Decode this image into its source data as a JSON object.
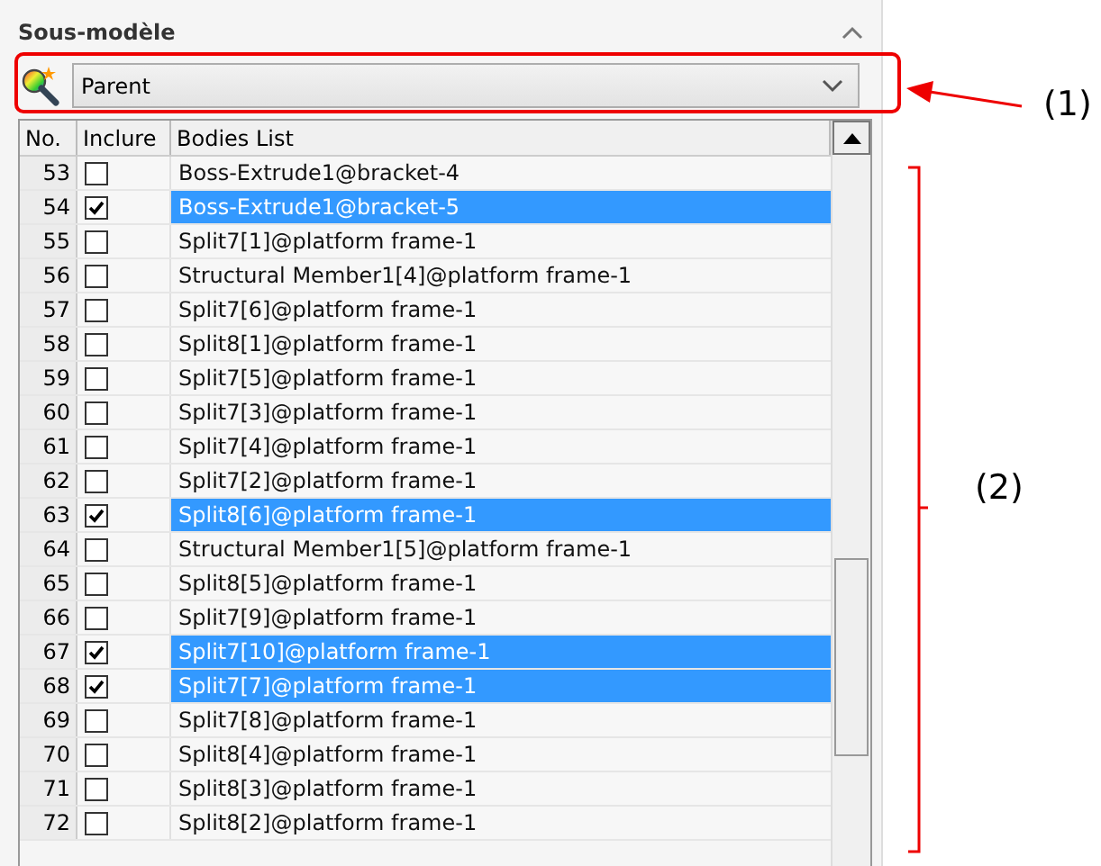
{
  "panel": {
    "title": "Sous-modèle",
    "collapsed": false
  },
  "dropdown": {
    "value": "Parent"
  },
  "table": {
    "columns": [
      "No.",
      "Inclure",
      "Bodies List"
    ],
    "rows": [
      {
        "no": "53",
        "checked": false,
        "selected": false,
        "name": "Boss-Extrude1@bracket-4"
      },
      {
        "no": "54",
        "checked": true,
        "selected": true,
        "name": "Boss-Extrude1@bracket-5"
      },
      {
        "no": "55",
        "checked": false,
        "selected": false,
        "name": "Split7[1]@platform frame-1"
      },
      {
        "no": "56",
        "checked": false,
        "selected": false,
        "name": "Structural Member1[4]@platform frame-1"
      },
      {
        "no": "57",
        "checked": false,
        "selected": false,
        "name": "Split7[6]@platform frame-1"
      },
      {
        "no": "58",
        "checked": false,
        "selected": false,
        "name": "Split8[1]@platform frame-1"
      },
      {
        "no": "59",
        "checked": false,
        "selected": false,
        "name": "Split7[5]@platform frame-1"
      },
      {
        "no": "60",
        "checked": false,
        "selected": false,
        "name": "Split7[3]@platform frame-1"
      },
      {
        "no": "61",
        "checked": false,
        "selected": false,
        "name": "Split7[4]@platform frame-1"
      },
      {
        "no": "62",
        "checked": false,
        "selected": false,
        "name": "Split7[2]@platform frame-1"
      },
      {
        "no": "63",
        "checked": true,
        "selected": true,
        "name": "Split8[6]@platform frame-1"
      },
      {
        "no": "64",
        "checked": false,
        "selected": false,
        "name": "Structural Member1[5]@platform frame-1"
      },
      {
        "no": "65",
        "checked": false,
        "selected": false,
        "name": "Split8[5]@platform frame-1"
      },
      {
        "no": "66",
        "checked": false,
        "selected": false,
        "name": "Split7[9]@platform frame-1"
      },
      {
        "no": "67",
        "checked": true,
        "selected": true,
        "name": "Split7[10]@platform frame-1"
      },
      {
        "no": "68",
        "checked": true,
        "selected": true,
        "name": "Split7[7]@platform frame-1"
      },
      {
        "no": "69",
        "checked": false,
        "selected": false,
        "name": "Split7[8]@platform frame-1"
      },
      {
        "no": "70",
        "checked": false,
        "selected": false,
        "name": "Split8[4]@platform frame-1"
      },
      {
        "no": "71",
        "checked": false,
        "selected": false,
        "name": "Split8[3]@platform frame-1"
      },
      {
        "no": "72",
        "checked": false,
        "selected": false,
        "name": "Split8[2]@platform frame-1"
      }
    ]
  },
  "annotations": [
    {
      "label": "(1)"
    },
    {
      "label": "(2)"
    }
  ]
}
